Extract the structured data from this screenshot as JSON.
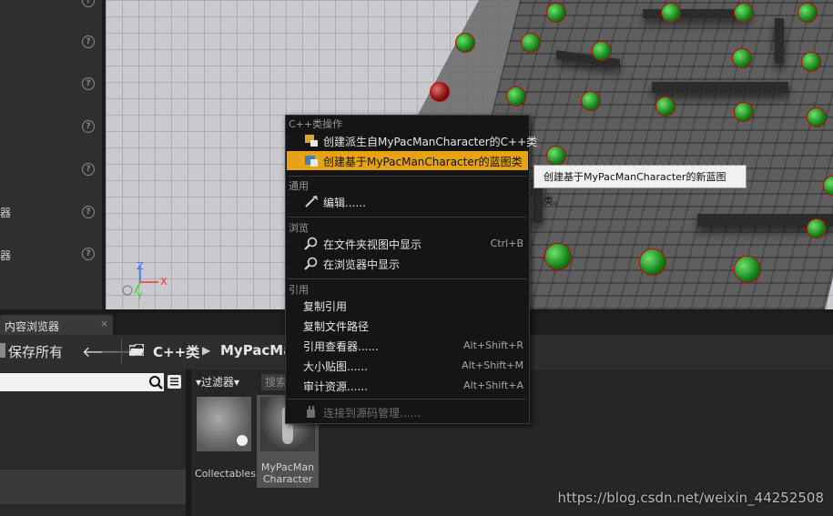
{
  "details_panel": {
    "labels": [
      "器",
      "器"
    ]
  },
  "icons": {
    "help": "help-icon",
    "save": "save-icon",
    "folder": "folder-icon",
    "search": "search-icon",
    "list_view": "list-view-icon"
  },
  "content_browser": {
    "tab_label": "内容浏览器",
    "tab_close": "×",
    "save_all": "保存所有",
    "nav_back": "🡐",
    "nav_forward": "🡒",
    "breadcrumb": [
      "C++类",
      "MyPacMan"
    ],
    "filter_label": "▾过滤器▾",
    "search_placeholder": "搜索",
    "assets": [
      {
        "name": "Collectables",
        "line1": "Collectables",
        "line2": ""
      },
      {
        "name": "MyPacManCharacter",
        "line1": "MyPacMan",
        "line2": "Character"
      }
    ]
  },
  "context_menu": {
    "sections": [
      {
        "title": "C++类操作",
        "items": [
          {
            "label": "创建派生自MyPacManCharacter的C++类",
            "icon": "cpp-class-icon",
            "shortcut": ""
          },
          {
            "label": "创建基于MyPacManCharacter的蓝图类",
            "icon": "blueprint-class-icon",
            "shortcut": "",
            "selected": true
          }
        ]
      },
      {
        "title": "通用",
        "items": [
          {
            "label": "编辑......",
            "icon": "wrench-icon",
            "shortcut": ""
          }
        ]
      },
      {
        "title": "浏览",
        "items": [
          {
            "label": "在文件夹视图中显示",
            "icon": "magnify-icon",
            "shortcut": "Ctrl+B"
          },
          {
            "label": "在浏览器中显示",
            "icon": "magnify-icon",
            "shortcut": ""
          }
        ]
      },
      {
        "title": "引用",
        "items": [
          {
            "label": "复制引用",
            "shortcut": ""
          },
          {
            "label": "复制文件路径",
            "shortcut": ""
          },
          {
            "label": "引用查看器......",
            "shortcut": "Alt+Shift+R"
          },
          {
            "label": "大小贴图......",
            "shortcut": "Alt+Shift+M"
          },
          {
            "label": "审计资源......",
            "shortcut": "Alt+Shift+A"
          },
          {
            "label": "连接到源码管理......",
            "icon": "source-control-icon",
            "shortcut": "",
            "disabled": true
          }
        ]
      }
    ],
    "tooltip": "创建基于MyPacManCharacter的新蓝图类。"
  },
  "viewport": {
    "axis_labels": {
      "x": "X",
      "y": "Y",
      "z": "Z"
    }
  },
  "watermark": "https://blog.csdn.net/weixin_44252508",
  "colors": {
    "menu_highlight": "#e6a313",
    "panel_bg": "#2f2f2f"
  }
}
